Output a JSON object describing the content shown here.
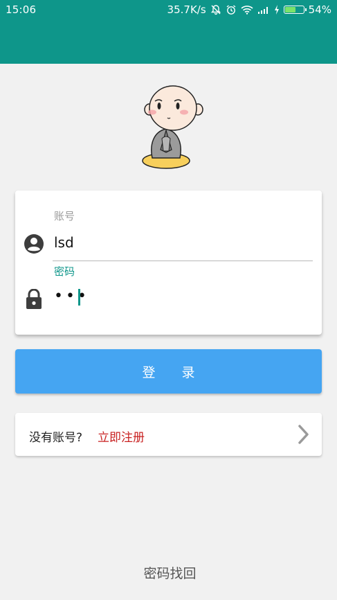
{
  "status_bar": {
    "time": "15:06",
    "net_speed": "35.7K/s",
    "battery": "54%",
    "battery_level": 0.54,
    "icons": [
      "bell-off-icon",
      "alarm-icon",
      "wifi-icon",
      "signal-icon",
      "charging-icon",
      "battery-icon"
    ]
  },
  "colors": {
    "header": "#0e968a",
    "accent": "#0e968a",
    "login_button": "#45a5f2",
    "register_link": "#c82020",
    "background": "#f1f1f1"
  },
  "login_form": {
    "username_label": "账号",
    "username_value": "lsd",
    "password_label": "密码",
    "password_value": "•••",
    "user_icon": "account-circle-icon",
    "lock_icon": "lock-icon"
  },
  "login_button": {
    "label": "登 录"
  },
  "register": {
    "question": "没有账号?",
    "link": "立即注册",
    "chevron_icon": "chevron-right-icon"
  },
  "recover": {
    "glyph": "",
    "label": "密码找回"
  },
  "mascot": {
    "icon": "monk-mascot-icon"
  }
}
